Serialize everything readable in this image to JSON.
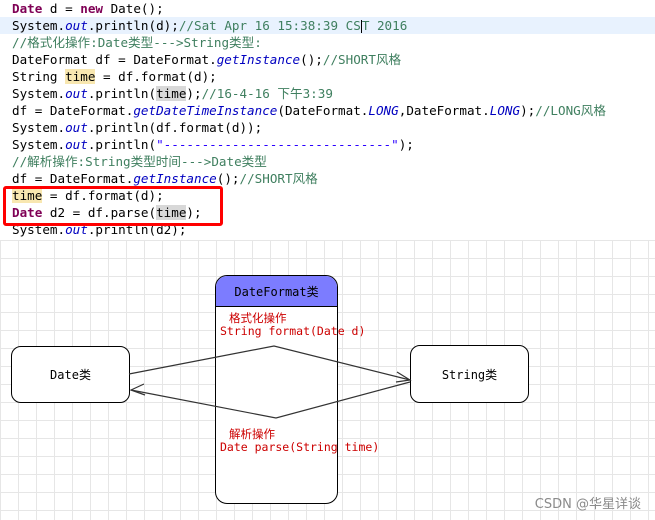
{
  "code": {
    "lines": [
      "Date d = new Date();",
      "System.out.println(d);//Sat Apr 16 15:38:39 CST 2016",
      "//格式化操作:Date类型--->String类型:",
      "DateFormat df = DateFormat.getInstance();//SHORT风格",
      "String time = df.format(d);",
      "System.out.println(time);//16-4-16 下午3:39",
      "df = DateFormat.getDateTimeInstance(DateFormat.LONG,DateFormat.LONG);//LONG风格",
      "System.out.println(df.format(d));",
      "System.out.println(\"------------------------------\");",
      "//解析操作:String类型时间--->Date类型",
      "df = DateFormat.getInstance();//SHORT风格",
      "time = df.format(d);",
      "Date d2 = df.parse(time);",
      "System.out.println(d2);"
    ]
  },
  "diagram": {
    "date_box": "Date类",
    "string_box": "String类",
    "dateformat_title": "DateFormat类",
    "format_title": "格式化操作",
    "format_sig": "String format(Date d)",
    "parse_title": "解析操作",
    "parse_sig": "Date parse(String time)"
  },
  "watermark": "CSDN @华星详谈",
  "colors": {
    "dateformat_header": "#7c7cff",
    "highlight_box": "#ff0000",
    "annotation_text": "#cc0000"
  }
}
